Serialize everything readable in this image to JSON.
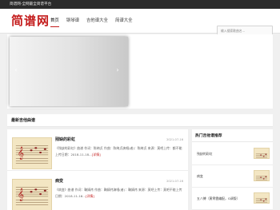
{
  "topbar": {
    "text": "简谱网-全网最全简谱平台"
  },
  "header": {
    "logo": "简谱网",
    "nav": [
      "首页",
      "钢琴谱",
      "吉他谱大全",
      "简谱大全"
    ],
    "search": {
      "placeholder": "输入搜索歌曲名..."
    }
  },
  "slider": {
    "prev": "‹",
    "next": "›"
  },
  "latest": {
    "title": "最新吉他曲谱",
    "articles": [
      {
        "title": "残缺的彩虹",
        "date": "2021-07-16",
        "desc": "《残缺的彩虹》曲谱 作词：陈绮贞 作曲：陈绮贞演唱(者)：陈绮贞 来源：莫吧上传：额不能上传日期：2018-11-18...",
        "more": "[详情]"
      },
      {
        "title": "病变",
        "date": "2021-07-16",
        "desc": "《病变》曲谱 作词：鞠婧祎 作曲：鞠婧祎演唱(者)：鞠婧祎 来源：莫吧上传：莫吧不能上传日期：2018-11-16...",
        "more": "[详情]"
      }
    ]
  },
  "hot": {
    "title": "热门吉他谱推荐",
    "items": [
      "残缺的彩虹",
      "病变",
      "五八搏（黄霄雲编配，G调版）"
    ]
  }
}
